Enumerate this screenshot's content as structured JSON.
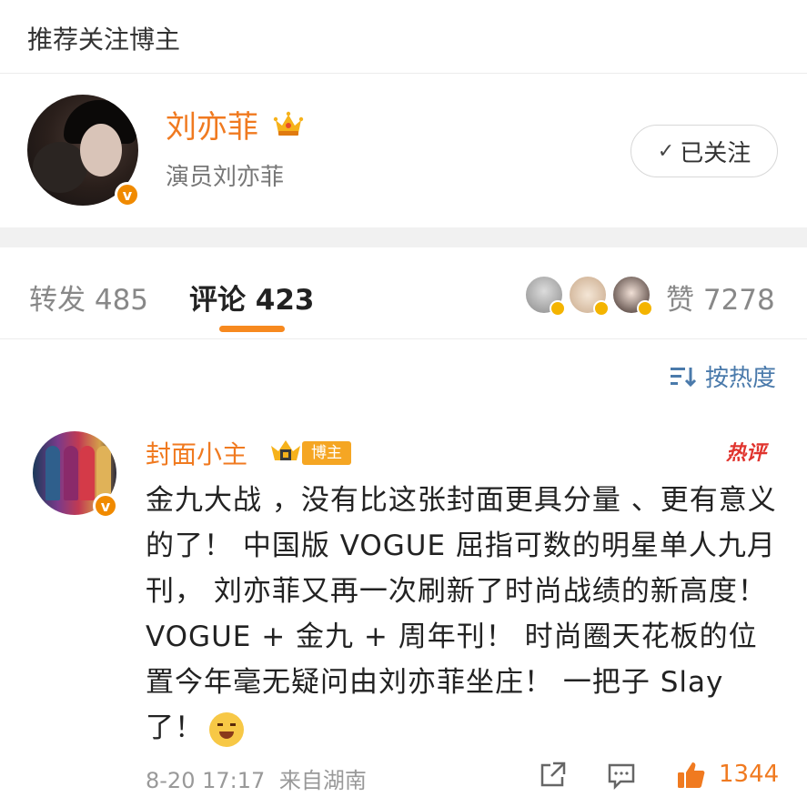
{
  "section": {
    "title": "推荐关注博主"
  },
  "profile": {
    "name": "刘亦菲",
    "description": "演员刘亦菲",
    "follow_button": "已关注",
    "badge_icon": "verified-v-icon",
    "name_color": "#f07a20"
  },
  "tabs": {
    "repost_label": "转发",
    "repost_count": "485",
    "comment_label": "评论",
    "comment_count": "423",
    "like_label": "赞",
    "like_count": "7278"
  },
  "sort": {
    "label": "按热度"
  },
  "comment": {
    "author": "封面小主",
    "role_badge": "博主",
    "hot_tag": "热评",
    "text": "金九大战 ，没有比这张封面更具分量 、更有意义的了！ 中国版 VOGUE 屈指可数的明星单人九月刊， 刘亦菲又再一次刷新了时尚战绩的新高度！ VOGUE + 金九 + 周年刊！ 时尚圈天花板的位置今年毫无疑问由刘亦菲坐庄！ 一把子 Slay 了！",
    "date": "8-20 17:17",
    "source": "来自湖南",
    "like_count": "1344"
  },
  "colors": {
    "accent": "#f07a20",
    "link": "#4a7aab",
    "badge": "#f5a623"
  }
}
